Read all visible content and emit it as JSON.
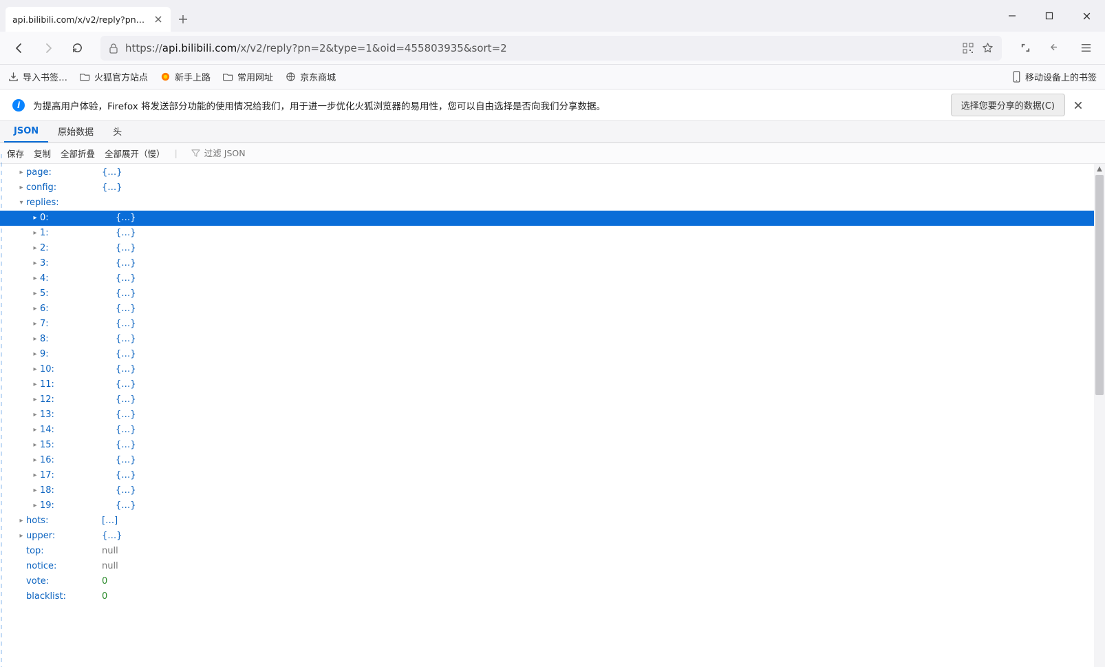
{
  "tab": {
    "title": "api.bilibili.com/x/v2/reply?pn=2&"
  },
  "url": {
    "prefix": "https://",
    "host": "api.bilibili.com",
    "path": "/x/v2/reply?pn=2&type=1&oid=455803935&sort=2"
  },
  "bookmarks": {
    "import": "导入书签…",
    "firefox_official": "火狐官方站点",
    "getting_started": "新手上路",
    "common": "常用网址",
    "jd": "京东商城",
    "mobile": "移动设备上的书签"
  },
  "infobar": {
    "text": "为提高用户体验，Firefox 将发送部分功能的使用情况给我们，用于进一步优化火狐浏览器的易用性，您可以自由选择是否向我们分享数据。",
    "button": "选择您要分享的数据(C)"
  },
  "jv": {
    "tabs": {
      "json": "JSON",
      "raw": "原始数据",
      "headers": "头"
    },
    "tools": {
      "save": "保存",
      "copy": "复制",
      "collapse_all": "全部折叠",
      "expand_all": "全部展开（慢）",
      "filter_placeholder": "过滤 JSON"
    }
  },
  "tree": {
    "page_key": "page:",
    "config_key": "config:",
    "replies_key": "replies:",
    "obj": "{…}",
    "arr": "[…]",
    "reply_indices": [
      "0:",
      "1:",
      "2:",
      "3:",
      "4:",
      "5:",
      "6:",
      "7:",
      "8:",
      "9:",
      "10:",
      "11:",
      "12:",
      "13:",
      "14:",
      "15:",
      "16:",
      "17:",
      "18:",
      "19:"
    ],
    "hots_key": "hots:",
    "upper_key": "upper:",
    "top_key": "top:",
    "notice_key": "notice:",
    "vote_key": "vote:",
    "blacklist_key": "blacklist:",
    "null": "null",
    "zero": "0"
  }
}
